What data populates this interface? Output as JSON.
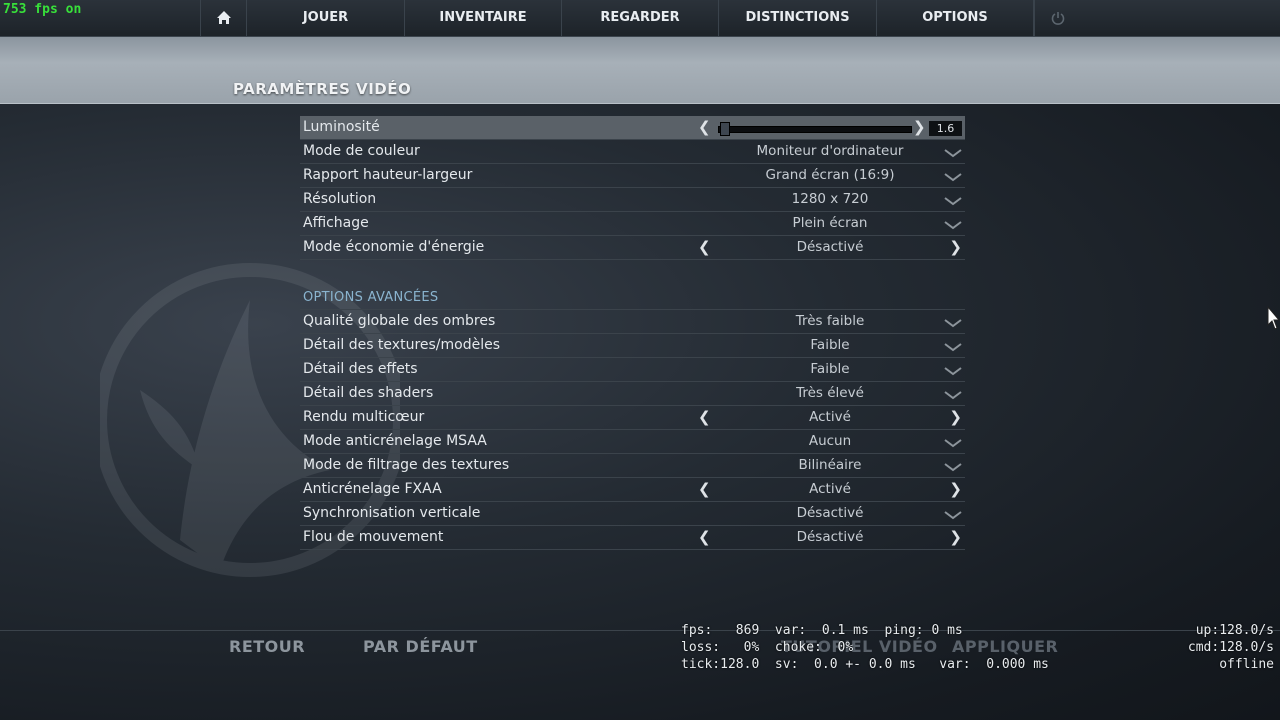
{
  "overlay": {
    "fps_counter": "753 fps on"
  },
  "nav": {
    "home_icon": "home-icon",
    "items": [
      "JOUER",
      "INVENTAIRE",
      "REGARDER",
      "DISTINCTIONS",
      "OPTIONS"
    ],
    "power_icon": "power-icon"
  },
  "page": {
    "title": "PARAMÈTRES VIDÉO"
  },
  "basic_settings": [
    {
      "label": "Luminosité",
      "control": "slider",
      "value": "1.6",
      "level": 0.02
    },
    {
      "label": "Mode de couleur",
      "control": "dropdown",
      "value": "Moniteur d'ordinateur"
    },
    {
      "label": "Rapport hauteur-largeur",
      "control": "dropdown",
      "value": "Grand écran (16:9)"
    },
    {
      "label": "Résolution",
      "control": "dropdown",
      "value": "1280 x 720"
    },
    {
      "label": "Affichage",
      "control": "dropdown",
      "value": "Plein écran"
    },
    {
      "label": "Mode économie d'énergie",
      "control": "toggle",
      "value": "Désactivé"
    }
  ],
  "advanced": {
    "heading": "OPTIONS AVANCÉES",
    "settings": [
      {
        "label": "Qualité globale des ombres",
        "control": "dropdown",
        "value": "Très faible"
      },
      {
        "label": "Détail des textures/modèles",
        "control": "dropdown",
        "value": "Faible"
      },
      {
        "label": "Détail des effets",
        "control": "dropdown",
        "value": "Faible"
      },
      {
        "label": "Détail des shaders",
        "control": "dropdown",
        "value": "Très élevé"
      },
      {
        "label": "Rendu multicœur",
        "control": "toggle",
        "value": "Activé"
      },
      {
        "label": "Mode anticrénelage MSAA",
        "control": "dropdown",
        "value": "Aucun"
      },
      {
        "label": "Mode de filtrage des textures",
        "control": "dropdown",
        "value": "Bilinéaire"
      },
      {
        "label": "Anticrénelage FXAA",
        "control": "toggle",
        "value": "Activé"
      },
      {
        "label": "Synchronisation verticale",
        "control": "dropdown",
        "value": "Désactivé"
      },
      {
        "label": "Flou de mouvement",
        "control": "toggle",
        "value": "Désactivé"
      }
    ]
  },
  "footer": {
    "back": "RETOUR",
    "default": "PAR DÉFAUT",
    "tutorial": "TUTORIEL VIDÉO",
    "apply": "APPLIQUER"
  },
  "net_graph": {
    "left": [
      "fps:   869  var:  0.1 ms  ping: 0 ms",
      "loss:   0%  choke:  0%",
      "tick:128.0  sv:  0.0 +- 0.0 ms   var:  0.000 ms"
    ],
    "right": [
      "up:128.0/s",
      "cmd:128.0/s",
      "offline"
    ]
  }
}
